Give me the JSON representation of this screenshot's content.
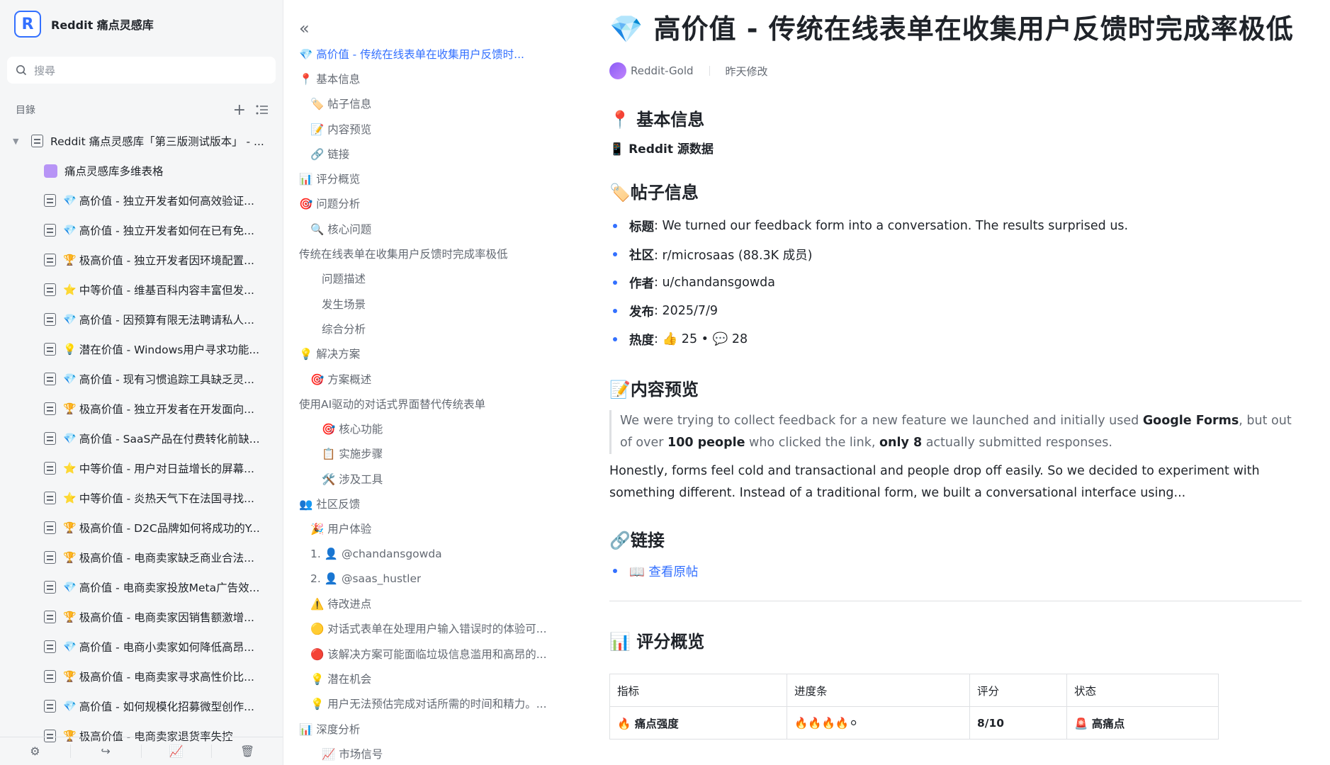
{
  "sidebar": {
    "app_title": "Reddit 痛点灵感库",
    "logo_letter": "R",
    "search_placeholder": "搜尋",
    "toc_label": "目錄",
    "root_item": "Reddit 痛点灵感库「第三版测试版本」 - ...",
    "items": [
      {
        "emoji": "",
        "label": "痛点灵感库多维表格",
        "type": "bitable"
      },
      {
        "emoji": "💎",
        "label": "高价值 - 独立开发者如何高效验证..."
      },
      {
        "emoji": "💎",
        "label": "高价值 - 独立开发者如何在已有免..."
      },
      {
        "emoji": "🏆",
        "label": "极高价值 - 独立开发者因环境配置..."
      },
      {
        "emoji": "⭐",
        "label": "中等价值 - 维基百科内容丰富但发..."
      },
      {
        "emoji": "💎",
        "label": "高价值 - 因预算有限无法聘请私人..."
      },
      {
        "emoji": "💡",
        "label": "潜在价值 - Windows用户寻求功能..."
      },
      {
        "emoji": "💎",
        "label": "高价值 - 现有习惯追踪工具缺乏灵..."
      },
      {
        "emoji": "🏆",
        "label": "极高价值 - 独立开发者在开发面向..."
      },
      {
        "emoji": "💎",
        "label": "高价值 - SaaS产品在付费转化前缺..."
      },
      {
        "emoji": "⭐",
        "label": "中等价值 - 用户对日益增长的屏幕..."
      },
      {
        "emoji": "⭐",
        "label": "中等价值 - 炎热天气下在法国寻找..."
      },
      {
        "emoji": "🏆",
        "label": "极高价值 - D2C品牌如何将成功的Y..."
      },
      {
        "emoji": "🏆",
        "label": "极高价值 - 电商卖家缺乏商业合法..."
      },
      {
        "emoji": "💎",
        "label": "高价值 - 电商卖家投放Meta广告效..."
      },
      {
        "emoji": "🏆",
        "label": "极高价值 - 电商卖家因销售额激增..."
      },
      {
        "emoji": "💎",
        "label": "高价值 - 电商小卖家如何降低高昂..."
      },
      {
        "emoji": "🏆",
        "label": "极高价值 - 电商卖家寻求高性价比..."
      },
      {
        "emoji": "💎",
        "label": "高价值 - 如何规模化招募微型创作..."
      },
      {
        "emoji": "🏆",
        "label": "极高价值 - 电商卖家退货率失控"
      }
    ]
  },
  "outline": [
    {
      "level": 0,
      "text": "💎 高价值 - 传统在线表单在收集用户反馈时...",
      "active": true
    },
    {
      "level": 0,
      "text": "📍 基本信息"
    },
    {
      "level": 1,
      "text": "🏷️ 帖子信息"
    },
    {
      "level": 1,
      "text": "📝 内容预览"
    },
    {
      "level": 1,
      "text": "🔗 链接"
    },
    {
      "level": 0,
      "text": "📊 评分概览"
    },
    {
      "level": 0,
      "text": "🎯 问题分析"
    },
    {
      "level": 1,
      "text": "🔍 核心问题"
    },
    {
      "level": 0,
      "text": "传统在线表单在收集用户反馈时完成率极低"
    },
    {
      "level": 2,
      "text": "问题描述"
    },
    {
      "level": 2,
      "text": "发生场景"
    },
    {
      "level": 2,
      "text": "综合分析"
    },
    {
      "level": 0,
      "text": "💡 解决方案"
    },
    {
      "level": 1,
      "text": "🎯 方案概述"
    },
    {
      "level": 0,
      "text": "使用AI驱动的对话式界面替代传统表单"
    },
    {
      "level": 2,
      "text": "🎯 核心功能"
    },
    {
      "level": 2,
      "text": "📋 实施步骤"
    },
    {
      "level": 2,
      "text": "🛠️ 涉及工具"
    },
    {
      "level": 0,
      "text": "👥 社区反馈"
    },
    {
      "level": 1,
      "text": "🎉 用户体验"
    },
    {
      "level": 1,
      "text": "1. 👤 @chandansgowda"
    },
    {
      "level": 1,
      "text": "2. 👤 @saas_hustler"
    },
    {
      "level": 1,
      "text": "⚠️ 待改进点"
    },
    {
      "level": 1,
      "text": "🟡 对话式表单在处理用户输入错误时的体验可..."
    },
    {
      "level": 1,
      "text": "🔴 该解决方案可能面临垃圾信息滥用和高昂的..."
    },
    {
      "level": 1,
      "text": "💡 潜在机会"
    },
    {
      "level": 1,
      "text": "💡 用户无法预估完成对话所需的时间和精力。..."
    },
    {
      "level": 0,
      "text": "📊 深度分析"
    },
    {
      "level": 2,
      "text": "📈 市场信号"
    }
  ],
  "doc": {
    "title": "💎 高价值 - 传统在线表单在收集用户反馈时完成率极低",
    "author": "Reddit-Gold",
    "modified": "昨天修改",
    "section_basic": "📍 基本信息",
    "source_label": "📱 Reddit 源数据",
    "section_post": "🏷️帖子信息",
    "post": {
      "title_key": "标题",
      "title_val": ": We turned our feedback form into a conversation. The results surprised us.",
      "community_key": "社区",
      "community_val": ": r/microsaas (88.3K 成员)",
      "author_key": "作者",
      "author_val": ": u/chandansgowda",
      "date_key": "发布",
      "date_val": ": 2025/7/9",
      "heat_key": "热度",
      "heat_val": ": 👍 25 • 💬 28"
    },
    "section_preview": "📝内容预览",
    "quote": {
      "p1": "We were trying to collect feedback for a new feature we launched and initially used ",
      "b1": "Google Forms",
      "p2": ", but out of over ",
      "b2": "100 people",
      "p3": " who clicked the link, ",
      "b3": "only 8",
      "p4": " actually submitted responses."
    },
    "paragraph": "Honestly, forms feel cold and transactional and people drop off easily. So we decided to experiment with something different. Instead of a traditional form, we built a conversational interface using...",
    "section_links": "🔗链接",
    "link_text": "📖 查看原帖",
    "section_score": "📊 评分概览",
    "table": {
      "headers": [
        "指标",
        "进度条",
        "评分",
        "状态"
      ],
      "rows": [
        [
          "🔥 痛点强度",
          "🔥🔥🔥🔥⚪",
          "8/10",
          "🚨 高痛点"
        ]
      ]
    }
  },
  "footer_icons": [
    "gear-icon",
    "share-icon",
    "chart-icon",
    "trash-icon"
  ]
}
